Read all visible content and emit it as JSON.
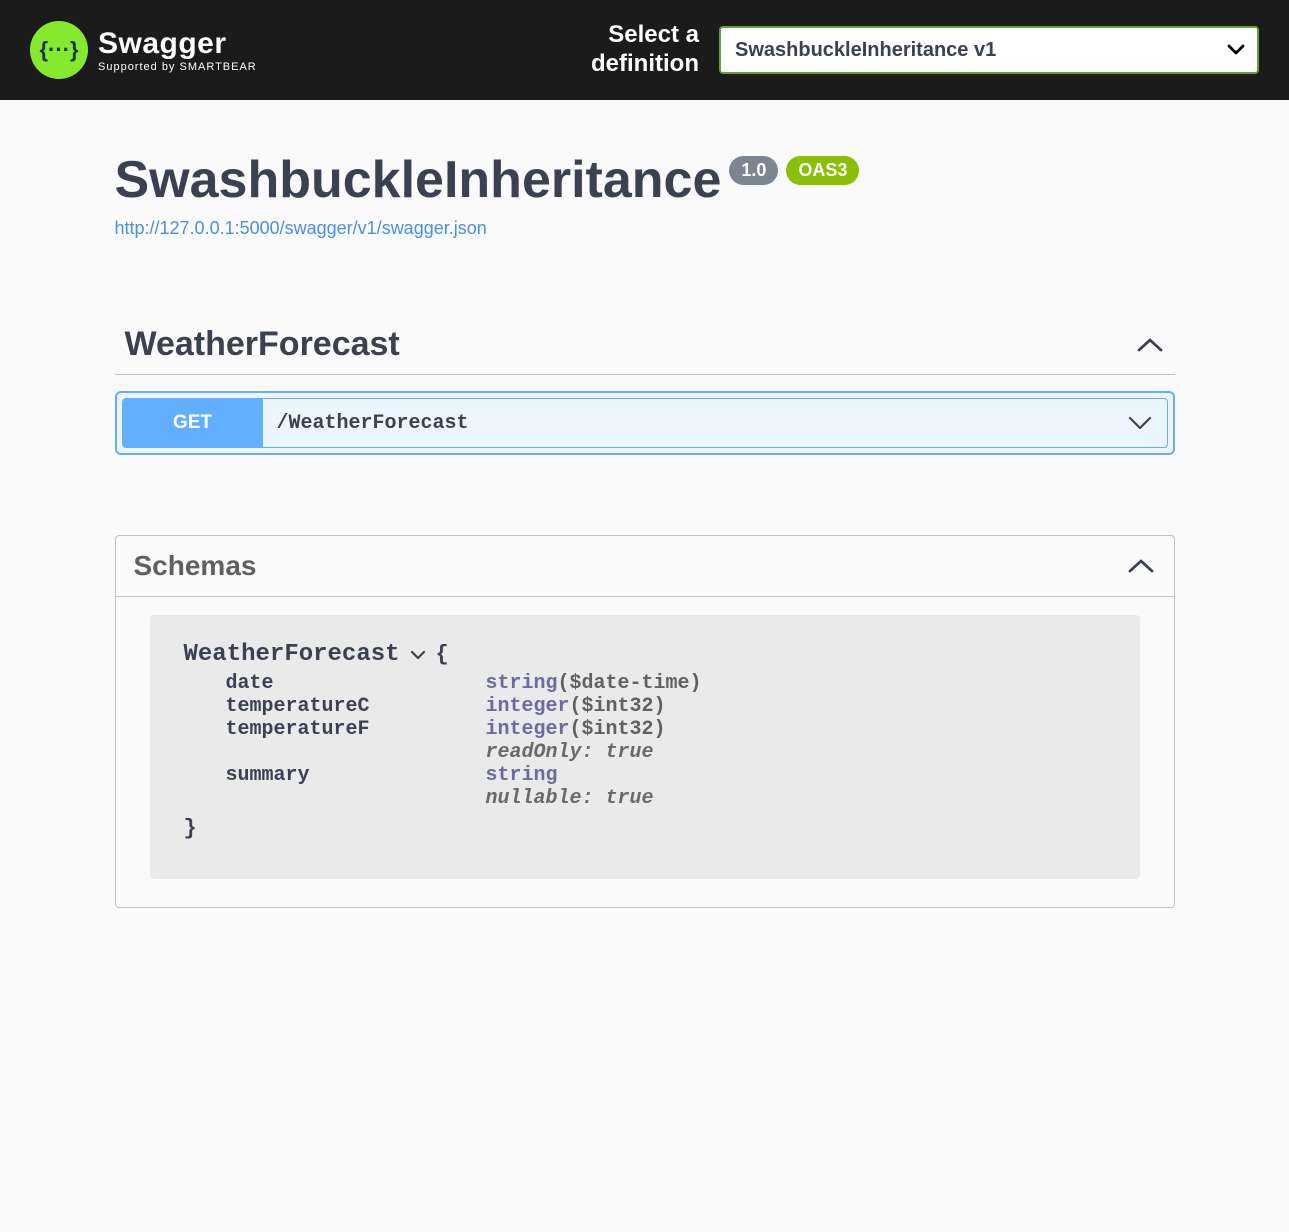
{
  "topbar": {
    "logo_main": "Swagger",
    "logo_sub": "Supported by SMARTBEAR",
    "select_label_line1": "Select a",
    "select_label_line2": "definition",
    "selected_definition": "SwashbuckleInheritance v1"
  },
  "info": {
    "title": "SwashbuckleInheritance",
    "version": "1.0",
    "oas_badge": "OAS3",
    "url": "http://127.0.0.1:5000/swagger/v1/swagger.json"
  },
  "tag": {
    "name": "WeatherForecast"
  },
  "operation": {
    "method": "GET",
    "path": "/WeatherForecast"
  },
  "schemas": {
    "title": "Schemas",
    "model_name": "WeatherForecast",
    "brace_open": "{",
    "brace_close": "}",
    "props": {
      "date": {
        "name": "date",
        "type": "string",
        "fmt": "($date-time)"
      },
      "tempC": {
        "name": "temperatureC",
        "type": "integer",
        "fmt": "($int32)"
      },
      "tempF": {
        "name": "temperatureF",
        "type": "integer",
        "fmt": "($int32)",
        "attr": "readOnly: true"
      },
      "summary": {
        "name": "summary",
        "type": "string",
        "attr": "nullable: true"
      }
    }
  }
}
